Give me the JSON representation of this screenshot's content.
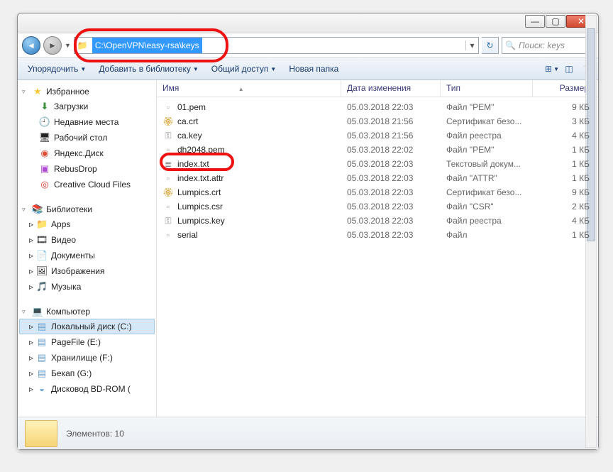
{
  "address_path": "C:\\OpenVPN\\easy-rsa\\keys",
  "search_placeholder": "Поиск: keys",
  "toolbar": {
    "organize": "Упорядочить",
    "add_lib": "Добавить в библиотеку",
    "share": "Общий доступ",
    "new_folder": "Новая папка"
  },
  "nav": {
    "favorites": "Избранное",
    "downloads": "Загрузки",
    "recent": "Недавние места",
    "desktop": "Рабочий стол",
    "yandex": "Яндекс.Диск",
    "rebus": "RebusDrop",
    "cc": "Creative Cloud Files",
    "libraries": "Библиотеки",
    "apps": "Apps",
    "video": "Видео",
    "documents": "Документы",
    "images": "Изображения",
    "music": "Музыка",
    "computer": "Компьютер",
    "drive_c": "Локальный диск (C:)",
    "drive_e": "PageFile (E:)",
    "drive_f": "Хранилище (F:)",
    "drive_g": "Бекап (G:)",
    "drive_bd": "Дисковод BD-ROM ("
  },
  "cols": {
    "name": "Имя",
    "date": "Дата изменения",
    "type": "Тип",
    "size": "Размер"
  },
  "files": [
    {
      "icon": "i-file",
      "name": "01.pem",
      "date": "05.03.2018 22:03",
      "type": "Файл \"PEM\"",
      "size": "9 КБ"
    },
    {
      "icon": "i-cert",
      "name": "ca.crt",
      "date": "05.03.2018 21:56",
      "type": "Сертификат безо...",
      "size": "3 КБ"
    },
    {
      "icon": "i-key",
      "name": "ca.key",
      "date": "05.03.2018 21:56",
      "type": "Файл реестра",
      "size": "4 КБ"
    },
    {
      "icon": "i-file",
      "name": "dh2048.pem",
      "date": "05.03.2018 22:02",
      "type": "Файл \"PEM\"",
      "size": "1 КБ"
    },
    {
      "icon": "i-txt",
      "name": "index.txt",
      "date": "05.03.2018 22:03",
      "type": "Текстовый докум...",
      "size": "1 КБ"
    },
    {
      "icon": "i-file",
      "name": "index.txt.attr",
      "date": "05.03.2018 22:03",
      "type": "Файл \"ATTR\"",
      "size": "1 КБ"
    },
    {
      "icon": "i-cert",
      "name": "Lumpics.crt",
      "date": "05.03.2018 22:03",
      "type": "Сертификат безо...",
      "size": "9 КБ"
    },
    {
      "icon": "i-file",
      "name": "Lumpics.csr",
      "date": "05.03.2018 22:03",
      "type": "Файл \"CSR\"",
      "size": "2 КБ"
    },
    {
      "icon": "i-key",
      "name": "Lumpics.key",
      "date": "05.03.2018 22:03",
      "type": "Файл реестра",
      "size": "4 КБ"
    },
    {
      "icon": "i-file",
      "name": "serial",
      "date": "05.03.2018 22:03",
      "type": "Файл",
      "size": "1 КБ"
    }
  ],
  "status": {
    "elements_label": "Элементов: 10"
  }
}
